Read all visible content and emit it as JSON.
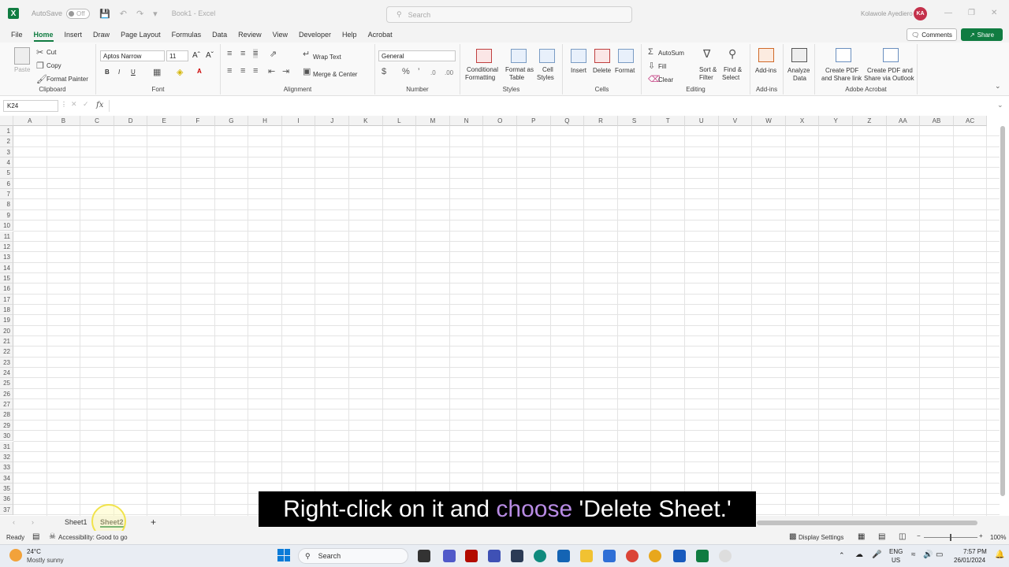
{
  "titlebar": {
    "autosave_label": "AutoSave",
    "autosave_state": "Off",
    "book_title": "Book1 - Excel",
    "search_placeholder": "Search",
    "user_name": "Kolawole Ayediero",
    "user_initials": "KA"
  },
  "menu": {
    "items": [
      "File",
      "Home",
      "Insert",
      "Draw",
      "Page Layout",
      "Formulas",
      "Data",
      "Review",
      "View",
      "Developer",
      "Help",
      "Acrobat"
    ],
    "active": "Home",
    "comments_label": "Comments",
    "share_label": "Share"
  },
  "ribbon": {
    "clipboard": {
      "paste": "Paste",
      "cut": "Cut",
      "copy": "Copy",
      "format_painter": "Format Painter",
      "label": "Clipboard"
    },
    "font": {
      "name": "Aptos Narrow",
      "size": "11",
      "label": "Font"
    },
    "alignment": {
      "wrap": "Wrap Text",
      "merge": "Merge & Center",
      "label": "Alignment"
    },
    "number": {
      "format": "General",
      "label": "Number"
    },
    "styles": {
      "conditional": "Conditional",
      "conditional2": "Formatting",
      "format_table": "Format as",
      "format_table2": "Table",
      "cell_styles": "Cell",
      "cell_styles2": "Styles",
      "label": "Styles"
    },
    "cells": {
      "insert": "Insert",
      "delete": "Delete",
      "format": "Format",
      "label": "Cells"
    },
    "editing": {
      "autosum": "AutoSum",
      "fill": "Fill",
      "clear": "Clear",
      "sort": "Sort &",
      "sort2": "Filter",
      "find": "Find &",
      "find2": "Select",
      "label": "Editing"
    },
    "addins": {
      "addins": "Add-ins",
      "label": "Add-ins"
    },
    "analyze": {
      "l1": "Analyze",
      "l2": "Data"
    },
    "acrobat": {
      "pdf1a": "Create PDF",
      "pdf1b": "and Share link",
      "pdf2a": "Create PDF and",
      "pdf2b": "Share via Outlook",
      "label": "Adobe Acrobat"
    }
  },
  "formula": {
    "namebox": "K24",
    "fx": "fx"
  },
  "grid": {
    "columns": [
      "A",
      "B",
      "C",
      "D",
      "E",
      "F",
      "G",
      "H",
      "I",
      "J",
      "K",
      "L",
      "M",
      "N",
      "O",
      "P",
      "Q",
      "R",
      "S",
      "T",
      "U",
      "V",
      "W",
      "X",
      "Y",
      "Z",
      "AA",
      "AB",
      "AC"
    ],
    "rows": 37
  },
  "sheets": {
    "tabs": [
      "Sheet1",
      "Sheet2"
    ],
    "active": "Sheet2",
    "add": "+"
  },
  "status": {
    "ready": "Ready",
    "accessibility": "Accessibility: Good to go",
    "display_settings": "Display Settings",
    "zoom": "100%"
  },
  "subtitle": {
    "pre": "Right-click on it and ",
    "highlight": "choose",
    "post": " 'Delete Sheet.'"
  },
  "taskbar": {
    "weather_temp": "24°C",
    "weather_desc": "Mostly sunny",
    "search": "Search",
    "lang1": "ENG",
    "lang2": "US",
    "time": "7:57 PM",
    "date": "26/01/2024"
  }
}
